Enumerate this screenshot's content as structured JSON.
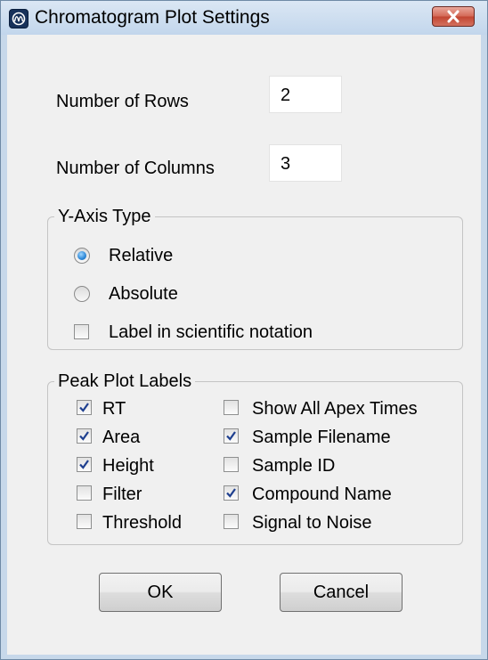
{
  "window": {
    "title": "Chromatogram Plot Settings",
    "app_icon": "app-logo-icon",
    "close_icon": "close-x-icon"
  },
  "fields": {
    "rows_label": "Number of Rows",
    "rows_value": "2",
    "columns_label": "Number of Columns",
    "columns_value": "3"
  },
  "y_axis": {
    "title": "Y-Axis Type",
    "options": [
      {
        "label": "Relative",
        "selected": true
      },
      {
        "label": "Absolute",
        "selected": false
      }
    ],
    "scientific_label": "Label in scientific notation",
    "scientific_checked": false
  },
  "peak_labels": {
    "title": "Peak Plot Labels",
    "left": [
      {
        "label": "RT",
        "checked": true
      },
      {
        "label": "Area",
        "checked": true
      },
      {
        "label": "Height",
        "checked": true
      },
      {
        "label": "Filter",
        "checked": false
      },
      {
        "label": "Threshold",
        "checked": false
      }
    ],
    "right": [
      {
        "label": "Show All Apex Times",
        "checked": false
      },
      {
        "label": "Sample Filename",
        "checked": true
      },
      {
        "label": "Sample ID",
        "checked": false
      },
      {
        "label": "Compound Name",
        "checked": true
      },
      {
        "label": "Signal to Noise",
        "checked": false
      }
    ]
  },
  "buttons": {
    "ok": "OK",
    "cancel": "Cancel"
  },
  "colors": {
    "title_bar": "#c7d8ea",
    "close_button": "#c9503c",
    "radio_fill": "#2b86d6",
    "check_mark": "#1e3f8f"
  }
}
